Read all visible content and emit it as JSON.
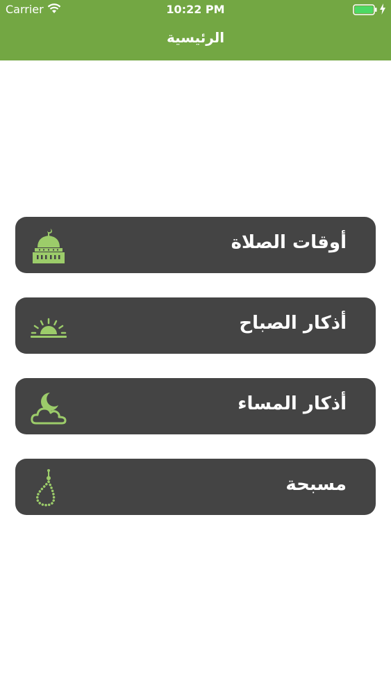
{
  "status_bar": {
    "carrier": "Carrier",
    "time": "10:22 PM",
    "wifi_icon": "wifi-icon",
    "battery_icon": "battery-icon",
    "charging_icon": "charging-bolt-icon",
    "battery_color": "#4cd964"
  },
  "header": {
    "title": "الرئيسية",
    "background_color": "#73a743"
  },
  "menu": {
    "item_background": "#444444",
    "icon_color": "#9ccc6a",
    "items": [
      {
        "label": "أوقات الصلاة",
        "icon": "mosque-icon"
      },
      {
        "label": "أذكار الصباح",
        "icon": "sunrise-icon"
      },
      {
        "label": "أذكار المساء",
        "icon": "moon-cloud-icon"
      },
      {
        "label": "مسبحة",
        "icon": "prayer-beads-icon"
      }
    ]
  }
}
